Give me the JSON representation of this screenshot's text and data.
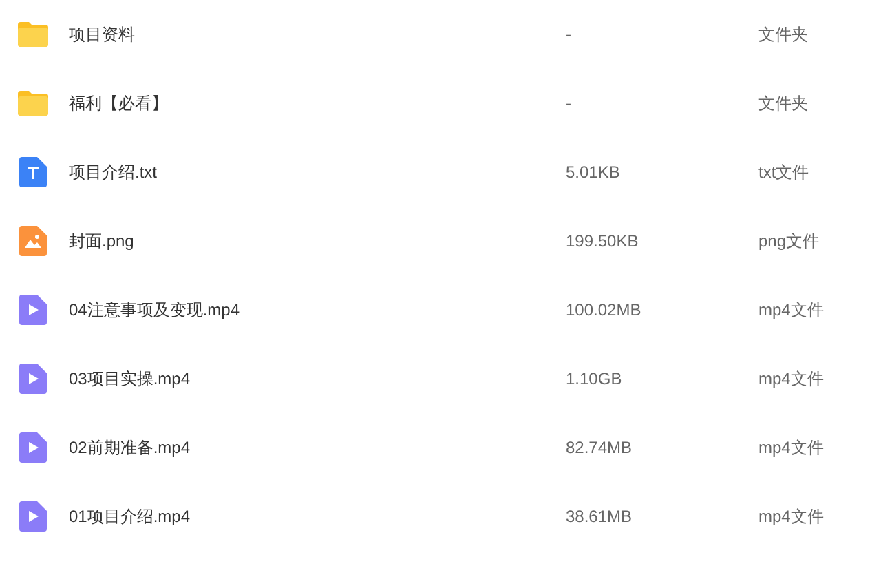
{
  "files": [
    {
      "kind": "folder",
      "name": "项目资料",
      "size": "-",
      "type": "文件夹"
    },
    {
      "kind": "folder",
      "name": "福利【必看】",
      "size": "-",
      "type": "文件夹"
    },
    {
      "kind": "text",
      "name": "项目介绍.txt",
      "size": "5.01KB",
      "type": "txt文件"
    },
    {
      "kind": "image",
      "name": "封面.png",
      "size": "199.50KB",
      "type": "png文件"
    },
    {
      "kind": "video",
      "name": "04注意事项及变现.mp4",
      "size": "100.02MB",
      "type": "mp4文件"
    },
    {
      "kind": "video",
      "name": "03项目实操.mp4",
      "size": "1.10GB",
      "type": "mp4文件"
    },
    {
      "kind": "video",
      "name": "02前期准备.mp4",
      "size": "82.74MB",
      "type": "mp4文件"
    },
    {
      "kind": "video",
      "name": "01项目介绍.mp4",
      "size": "38.61MB",
      "type": "mp4文件"
    }
  ]
}
